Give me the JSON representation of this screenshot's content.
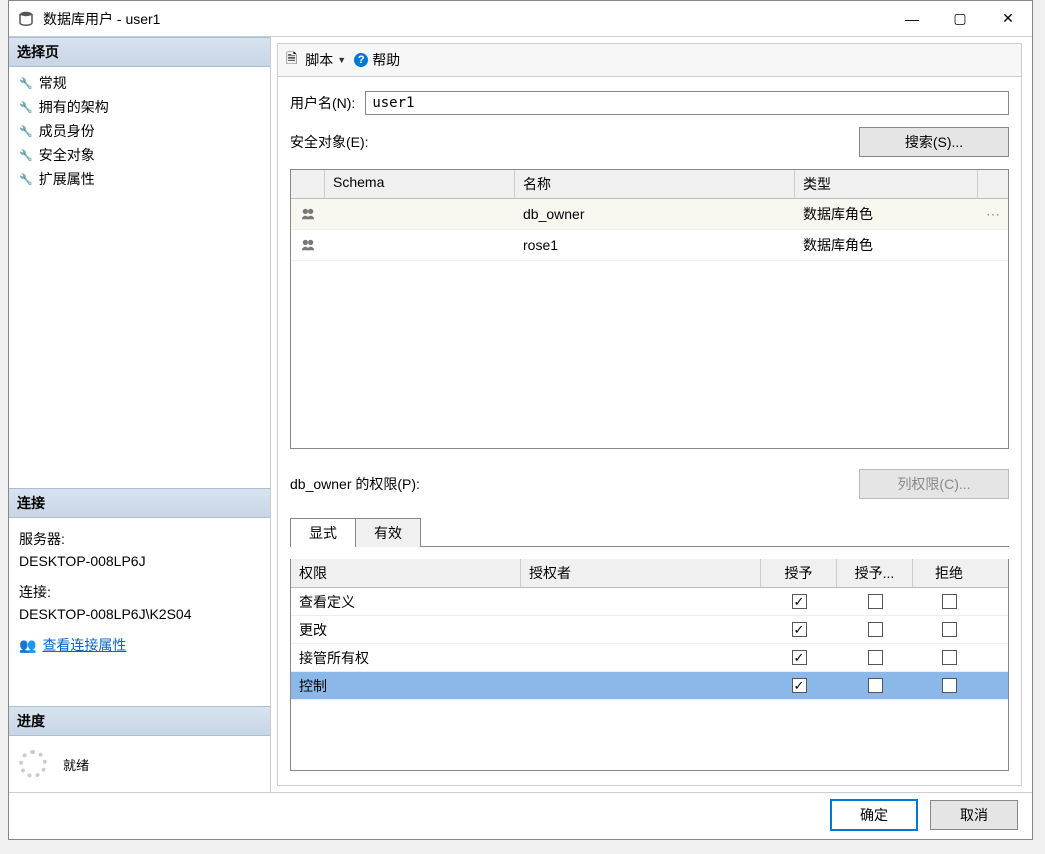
{
  "window": {
    "title": "数据库用户 - user1"
  },
  "leftPanel": {
    "selectPage": {
      "header": "选择页",
      "items": [
        "常规",
        "拥有的架构",
        "成员身份",
        "安全对象",
        "扩展属性"
      ]
    },
    "connection": {
      "header": "连接",
      "serverLabel": "服务器:",
      "serverValue": "DESKTOP-008LP6J",
      "connLabel": "连接:",
      "connValue": "DESKTOP-008LP6J\\K2S04",
      "propsLink": "查看连接属性"
    },
    "progress": {
      "header": "进度",
      "status": "就绪"
    }
  },
  "toolbar": {
    "scriptLabel": "脚本",
    "helpLabel": "帮助"
  },
  "form": {
    "userNameLabel": "用户名(N):",
    "userNameValue": "user1",
    "securablesLabel": "安全对象(E):",
    "searchBtn": "搜索(S)...",
    "permissionsLabel": "db_owner 的权限(P):",
    "columnPermsBtn": "列权限(C)..."
  },
  "securablesGrid": {
    "headers": {
      "schema": "Schema",
      "name": "名称",
      "type": "类型"
    },
    "rows": [
      {
        "schema": "",
        "name": "db_owner",
        "type": "数据库角色",
        "selected": true
      },
      {
        "schema": "",
        "name": "rose1",
        "type": "数据库角色",
        "selected": false
      }
    ]
  },
  "tabs": {
    "explicit": "显式",
    "effective": "有效"
  },
  "permGrid": {
    "headers": {
      "perm": "权限",
      "grantor": "授权者",
      "grant": "授予",
      "grantWith": "授予...",
      "deny": "拒绝"
    },
    "rows": [
      {
        "perm": "查看定义",
        "grant": true,
        "grantWith": false,
        "deny": false,
        "selected": false
      },
      {
        "perm": "更改",
        "grant": true,
        "grantWith": false,
        "deny": false,
        "selected": false
      },
      {
        "perm": "接管所有权",
        "grant": true,
        "grantWith": false,
        "deny": false,
        "selected": false
      },
      {
        "perm": "控制",
        "grant": true,
        "grantWith": false,
        "deny": false,
        "selected": true
      }
    ]
  },
  "footer": {
    "ok": "确定",
    "cancel": "取消"
  }
}
